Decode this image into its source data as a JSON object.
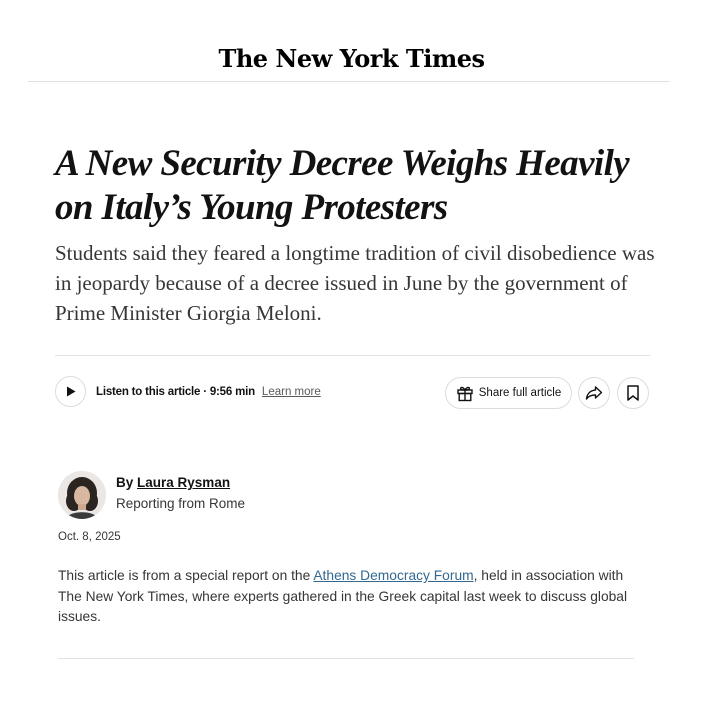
{
  "masthead": {
    "logo_text": "The New York Times"
  },
  "article": {
    "headline": "A New Security Decree Weighs Heavily on Italy’s Young Protesters",
    "summary": "Students said they feared a longtime tradition of civil disobedience was in jeopardy because of a decree issued in June by the government of Prime Minister Giorgia Meloni."
  },
  "toolbar": {
    "listen_label": "Listen to this article · 9:56 min",
    "learn_more_label": "Learn more",
    "share_label": "Share full article",
    "icons": {
      "play": "play-icon",
      "gift": "gift-icon",
      "forward": "share-forward-icon",
      "bookmark": "bookmark-icon"
    }
  },
  "byline": {
    "prefix": "By",
    "author": "Laura Rysman",
    "dateline": "Reporting from Rome",
    "date": "Oct. 8, 2025"
  },
  "body": {
    "intro_before": "This article is from a special report on the ",
    "intro_link": "Athens Democracy Forum",
    "intro_after": ", held in association with The New York Times, where experts gathered in the Greek capital last week to discuss global issues."
  },
  "colors": {
    "link": "#326891",
    "text": "#121212",
    "secondary_text": "#363636",
    "divider": "#e2e2e2"
  }
}
